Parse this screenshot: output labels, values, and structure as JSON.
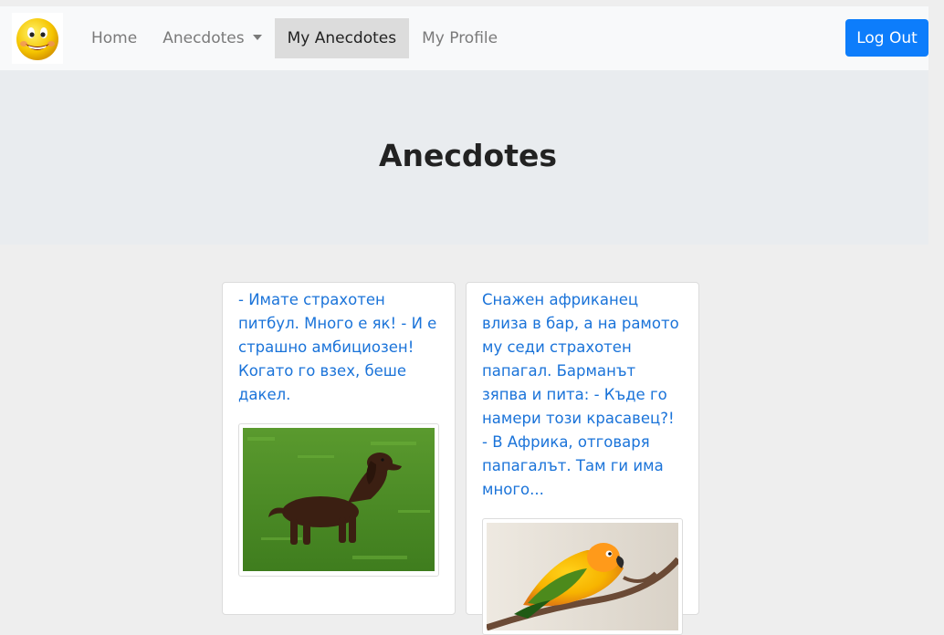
{
  "nav": {
    "logo_icon": "smiley-face-icon",
    "links": [
      {
        "label": "Home",
        "active": false
      },
      {
        "label": "Anecdotes",
        "active": false,
        "dropdown": true
      },
      {
        "label": "My Anecdotes",
        "active": true
      },
      {
        "label": "My Profile",
        "active": false
      }
    ],
    "logout_label": "Log Out"
  },
  "hero": {
    "title": "Anecdotes"
  },
  "cards": [
    {
      "text": "- Имате страхотен питбул. Много е як! - И е страшно амбициозен! Когато го взех, беше дакел.",
      "image": "dachshund-photo"
    },
    {
      "text": "Снажен африканец влиза в бар, а на рамото му седи страхотен папагал. Барманът зяпва и пита: - Къде го намери този красавец?! - В Африка, отговаря папагалът. Там ги има много...",
      "image": "parrot-photo"
    }
  ],
  "colors": {
    "navbar_bg": "#f8f9fa",
    "hero_bg": "#e9ecef",
    "page_bg": "#eeeeee",
    "primary": "#0d7dfb",
    "link": "#1a73d9"
  }
}
